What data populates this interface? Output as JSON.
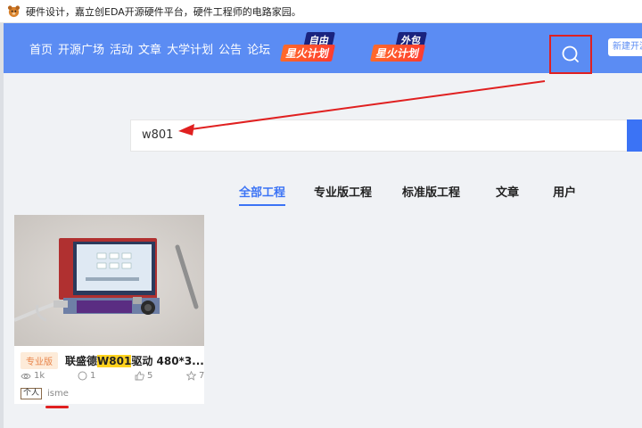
{
  "window": {
    "title": "硬件设计，嘉立创EDA开源硬件平台，硬件工程师的电路家园。"
  },
  "header": {
    "nav": [
      "首页",
      "开源广场",
      "活动",
      "文章",
      "大学计划",
      "公告",
      "论坛"
    ],
    "badge1": {
      "top": "自由",
      "bottom": "星火计划"
    },
    "badge2": {
      "top": "外包",
      "bottom": "星火计划"
    },
    "new_project_label": "新建开源"
  },
  "search": {
    "value": "w801"
  },
  "tabs": [
    "全部工程",
    "专业版工程",
    "标准版工程",
    "文章",
    "用户"
  ],
  "results": [
    {
      "edition_tag": "专业版",
      "title_prefix": "联盛德",
      "title_highlight": "W801",
      "title_suffix": "驱动 480*3...",
      "views": "1k",
      "comments": "1",
      "likes": "5",
      "favorites": "7",
      "owner_type": "个人",
      "owner": "isme"
    }
  ],
  "colors": {
    "header_bg": "#5b8cf3",
    "accent": "#3b73f5",
    "annotation": "#e02020",
    "highlight": "#ffd21f"
  }
}
